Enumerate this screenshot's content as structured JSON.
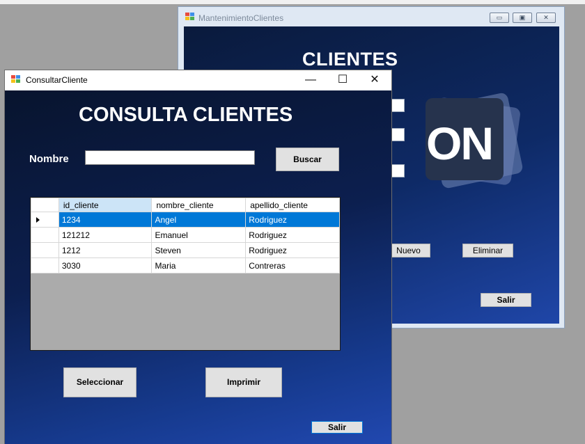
{
  "back_window": {
    "title": "MantenimientoClientes",
    "heading": "CLIENTES",
    "logo_text": "ON",
    "buttons": {
      "nuevo": "Nuevo",
      "eliminar": "Eliminar",
      "salir": "Salir"
    }
  },
  "front_window": {
    "title": "ConsultarCliente",
    "heading": "CONSULTA CLIENTES",
    "search": {
      "label": "Nombre",
      "value": "",
      "button": "Buscar"
    },
    "grid": {
      "columns": [
        "id_cliente",
        "nombre_cliente",
        "apellido_cliente"
      ],
      "rows": [
        [
          "1234",
          "Angel",
          "Rodriguez"
        ],
        [
          "121212",
          "Emanuel",
          "Rodriguez"
        ],
        [
          "1212",
          "Steven",
          "Rodriguez"
        ],
        [
          "3030",
          "Maria",
          "Contreras"
        ]
      ]
    },
    "buttons": {
      "seleccionar": "Seleccionar",
      "imprimir": "Imprimir",
      "salir": "Salir"
    }
  },
  "colors": {
    "selection": "#0078d7",
    "header_selected": "#cce4f7",
    "form_background": "#0c1f4f"
  }
}
